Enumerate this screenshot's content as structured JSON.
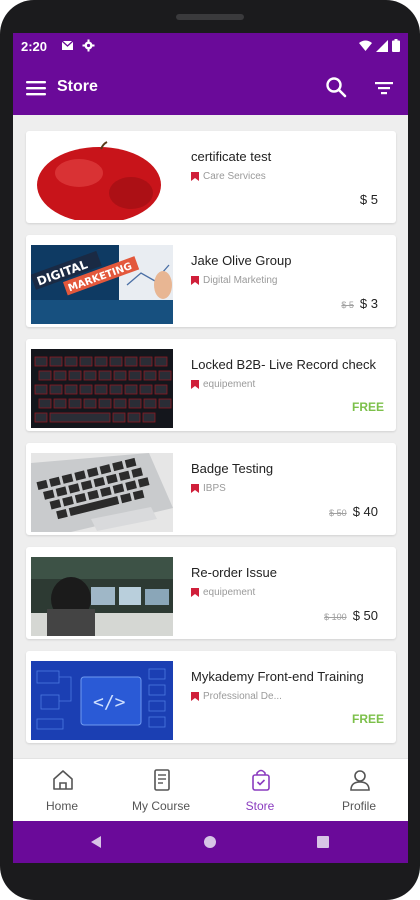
{
  "status_bar": {
    "time": "2:20"
  },
  "app_bar": {
    "title": "Store"
  },
  "colors": {
    "primary": "#6a0a99",
    "free": "#7cc04a",
    "flag": "#d01f3a",
    "active_nav": "#8a3bbf"
  },
  "courses": [
    {
      "title": "certificate test",
      "category": "Care Services",
      "old_price": "",
      "price": "$ 5",
      "free": ""
    },
    {
      "title": "Jake Olive Group",
      "category": "Digital Marketing",
      "old_price": "$ 5",
      "price": "$ 3",
      "free": ""
    },
    {
      "title": "Locked B2B- Live Record check",
      "category": "equipement",
      "old_price": "",
      "price": "",
      "free": "FREE"
    },
    {
      "title": "Badge Testing",
      "category": "IBPS",
      "old_price": "$ 50",
      "price": "$ 40",
      "free": ""
    },
    {
      "title": "Re-order Issue",
      "category": "equipement",
      "old_price": "$ 100",
      "price": "$ 50",
      "free": ""
    },
    {
      "title": "Mykademy Front-end Training",
      "category": "Professional De...",
      "old_price": "",
      "price": "",
      "free": "FREE"
    }
  ],
  "thumbnails": {
    "digital_marketing": [
      "DIGITAL",
      "MARKETING"
    ]
  },
  "bottom_nav": [
    {
      "label": "Home",
      "icon": "home-icon"
    },
    {
      "label": "My Course",
      "icon": "course-icon"
    },
    {
      "label": "Store",
      "icon": "store-bag-icon",
      "active": true
    },
    {
      "label": "Profile",
      "icon": "profile-icon"
    }
  ]
}
